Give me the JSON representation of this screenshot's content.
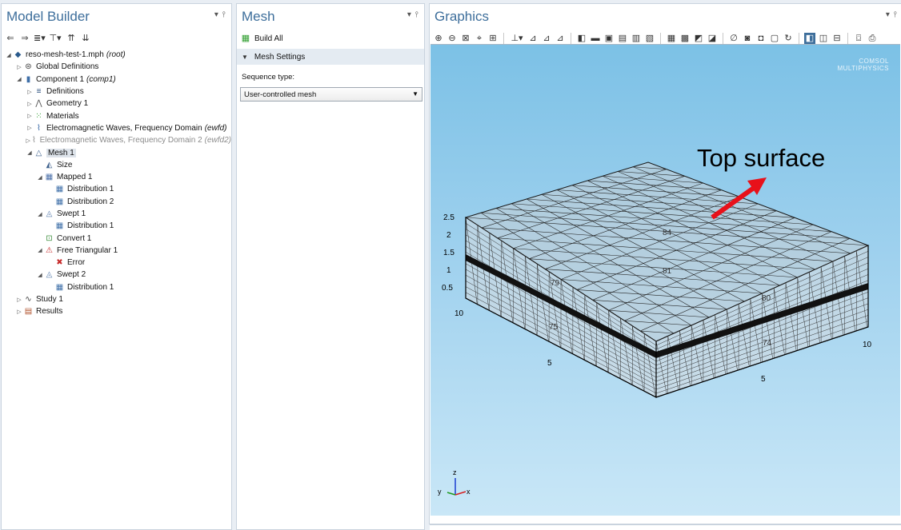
{
  "model_builder": {
    "title": "Model Builder",
    "tree": [
      {
        "label": "reso-mesh-test-1.mph",
        "suffix": "(root)",
        "level": 0,
        "twisty": "◢",
        "icon": "◆",
        "icon_color": "#2a5a8c"
      },
      {
        "label": "Global Definitions",
        "suffix": "",
        "level": 1,
        "twisty": "▷",
        "icon": "⊜",
        "icon_color": "#333"
      },
      {
        "label": "Component 1",
        "suffix": "(comp1)",
        "level": 1,
        "twisty": "◢",
        "icon": "▮",
        "icon_color": "#3e6fa8"
      },
      {
        "label": "Definitions",
        "suffix": "",
        "level": 2,
        "twisty": "▷",
        "icon": "≡",
        "icon_color": "#2b4f7e"
      },
      {
        "label": "Geometry 1",
        "suffix": "",
        "level": 2,
        "twisty": "▷",
        "icon": "⋀",
        "icon_color": "#555"
      },
      {
        "label": "Materials",
        "suffix": "",
        "level": 2,
        "twisty": "▷",
        "icon": "⁙",
        "icon_color": "#2e9d2e"
      },
      {
        "label": "Electromagnetic Waves, Frequency Domain",
        "suffix": "(ewfd)",
        "level": 2,
        "twisty": "▷",
        "icon": "⌇",
        "icon_color": "#2b5ea0"
      },
      {
        "label": "Electromagnetic Waves, Frequency Domain 2",
        "suffix": "(ewfd2)",
        "level": 2,
        "twisty": "▷",
        "icon": "⌇",
        "icon_color": "#888",
        "dim": true
      },
      {
        "label": "Mesh 1",
        "suffix": "",
        "level": 2,
        "twisty": "◢",
        "icon": "△",
        "icon_color": "#3c5f8c",
        "selected": true
      },
      {
        "label": "Size",
        "suffix": "",
        "level": 3,
        "twisty": "",
        "icon": "◭",
        "icon_color": "#3c5f8c"
      },
      {
        "label": "Mapped 1",
        "suffix": "",
        "level": 3,
        "twisty": "◢",
        "icon": "▦",
        "icon_color": "#4a6fa8"
      },
      {
        "label": "Distribution 1",
        "suffix": "",
        "level": 4,
        "twisty": "",
        "icon": "▦",
        "icon_color": "#3e6fa8"
      },
      {
        "label": "Distribution 2",
        "suffix": "",
        "level": 4,
        "twisty": "",
        "icon": "▦",
        "icon_color": "#3e6fa8"
      },
      {
        "label": "Swept 1",
        "suffix": "",
        "level": 3,
        "twisty": "◢",
        "icon": "◬",
        "icon_color": "#5b7fae"
      },
      {
        "label": "Distribution 1",
        "suffix": "",
        "level": 4,
        "twisty": "",
        "icon": "▦",
        "icon_color": "#3e6fa8"
      },
      {
        "label": "Convert 1",
        "suffix": "",
        "level": 3,
        "twisty": "",
        "icon": "⊡",
        "icon_color": "#3e8e3e"
      },
      {
        "label": "Free Triangular 1",
        "suffix": "",
        "level": 3,
        "twisty": "◢",
        "icon": "⚠",
        "icon_color": "#c62828"
      },
      {
        "label": "Error",
        "suffix": "",
        "level": 4,
        "twisty": "",
        "icon": "✖",
        "icon_color": "#c62828"
      },
      {
        "label": "Swept 2",
        "suffix": "",
        "level": 3,
        "twisty": "◢",
        "icon": "◬",
        "icon_color": "#5b7fae"
      },
      {
        "label": "Distribution 1",
        "suffix": "",
        "level": 4,
        "twisty": "",
        "icon": "▦",
        "icon_color": "#3e6fa8"
      },
      {
        "label": "Study 1",
        "suffix": "",
        "level": 1,
        "twisty": "▷",
        "icon": "∿",
        "icon_color": "#444"
      },
      {
        "label": "Results",
        "suffix": "",
        "level": 1,
        "twisty": "▷",
        "icon": "▤",
        "icon_color": "#b0502a"
      }
    ]
  },
  "mesh_panel": {
    "title": "Mesh",
    "build_all": "Build All",
    "section": "Mesh Settings",
    "sequence_label": "Sequence type:",
    "sequence_value": "User-controlled mesh"
  },
  "graphics": {
    "title": "Graphics",
    "annotation": "Top surface",
    "logo_line1": "COMSOL",
    "logo_line2": "MULTIPHYSICS",
    "axis_labels": {
      "z_ticks": [
        "2.5",
        "2",
        "1.5",
        "1",
        "0.5"
      ],
      "left_ticks": [
        "10",
        "5"
      ],
      "right_ticks": [
        "10",
        "5"
      ],
      "inner_numbers": [
        "84",
        "81",
        "79",
        "80",
        "75",
        "74"
      ]
    },
    "triad": {
      "z": "z",
      "y": "y",
      "x": "x"
    }
  },
  "colors": {
    "accent_blue": "#3d6e9b",
    "arrow_red": "#e8111a",
    "viewport_top": "#7cc1e6",
    "viewport_bottom": "#c9e7f7"
  }
}
